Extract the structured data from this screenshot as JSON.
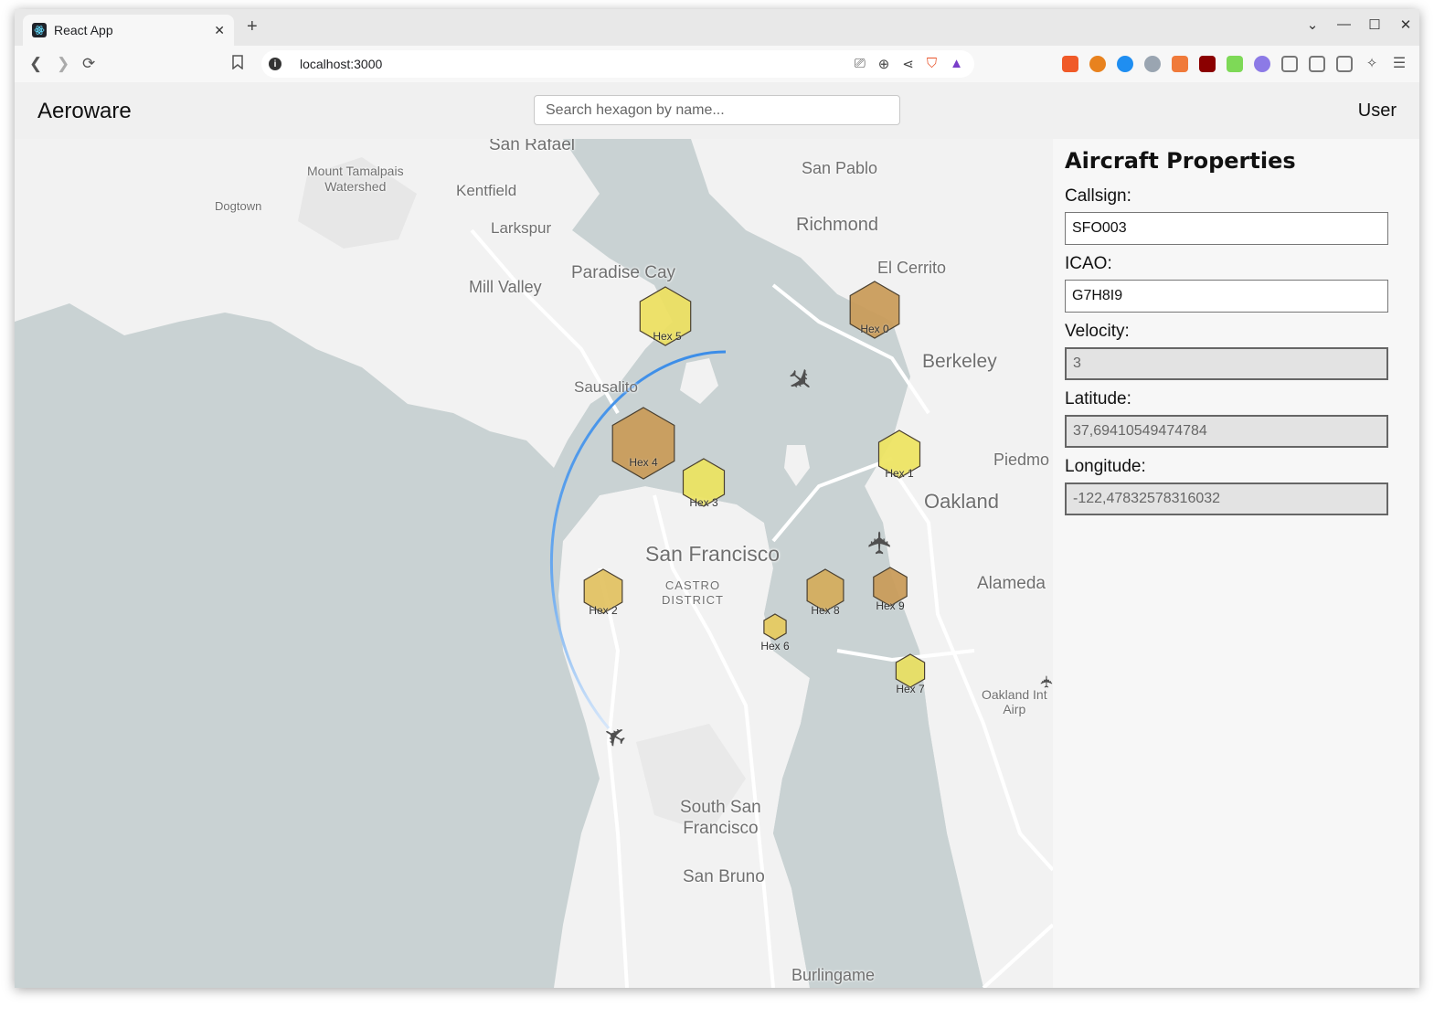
{
  "browser": {
    "tab_title": "React App",
    "tab_close": "✕",
    "new_tab": "+",
    "url": "localhost:3000",
    "window_controls": [
      "⌄",
      "—",
      "☐",
      "✕"
    ]
  },
  "app": {
    "brand": "Aeroware",
    "search_placeholder": "Search hexagon by name...",
    "user_label": "User"
  },
  "map": {
    "places": [
      {
        "name": "San Rafael"
      },
      {
        "name": "San Pablo"
      },
      {
        "name": "Mount Tamalpais\nWatershed"
      },
      {
        "name": "Kentfield"
      },
      {
        "name": "Dogtown"
      },
      {
        "name": "Richmond"
      },
      {
        "name": "Larkspur"
      },
      {
        "name": "El Cerrito"
      },
      {
        "name": "Paradise Cay"
      },
      {
        "name": "Mill Valley"
      },
      {
        "name": "Berkeley"
      },
      {
        "name": "Sausalito"
      },
      {
        "name": "Piedmo"
      },
      {
        "name": "Oakland"
      },
      {
        "name": "San Francisco"
      },
      {
        "name": "CASTRO\nDISTRICT"
      },
      {
        "name": "Alameda"
      },
      {
        "name": "Oakland Int\nAirp"
      },
      {
        "name": "South San\nFrancisco"
      },
      {
        "name": "San Bruno"
      },
      {
        "name": "Burlingame"
      }
    ],
    "hexagons": [
      {
        "name": "Hex 0",
        "color": "#c99a57"
      },
      {
        "name": "Hex 1",
        "color": "#eee45f"
      },
      {
        "name": "Hex 2",
        "color": "#e2c160"
      },
      {
        "name": "Hex 3",
        "color": "#ece35e"
      },
      {
        "name": "Hex 4",
        "color": "#c99a57"
      },
      {
        "name": "Hex 5",
        "color": "#ede05e"
      },
      {
        "name": "Hex 6",
        "color": "#e6ca5d"
      },
      {
        "name": "Hex 7",
        "color": "#e8de60"
      },
      {
        "name": "Hex 8",
        "color": "#d4ab5a"
      },
      {
        "name": "Hex 9",
        "color": "#c99a57"
      }
    ],
    "planes": [
      {
        "name": "plane-north"
      },
      {
        "name": "plane-east"
      },
      {
        "name": "plane-south-west"
      }
    ],
    "trail_color": "#3b8de8"
  },
  "panel": {
    "title": "Aircraft Properties",
    "fields": [
      {
        "label": "Callsign:",
        "value": "SFO003"
      },
      {
        "label": "ICAO:",
        "value": "G7H8I9"
      },
      {
        "label": "Velocity:",
        "value": "3"
      },
      {
        "label": "Latitude:",
        "value": "37,69410549474784"
      },
      {
        "label": "Longitude:",
        "value": "-122,47832578316032"
      }
    ]
  }
}
